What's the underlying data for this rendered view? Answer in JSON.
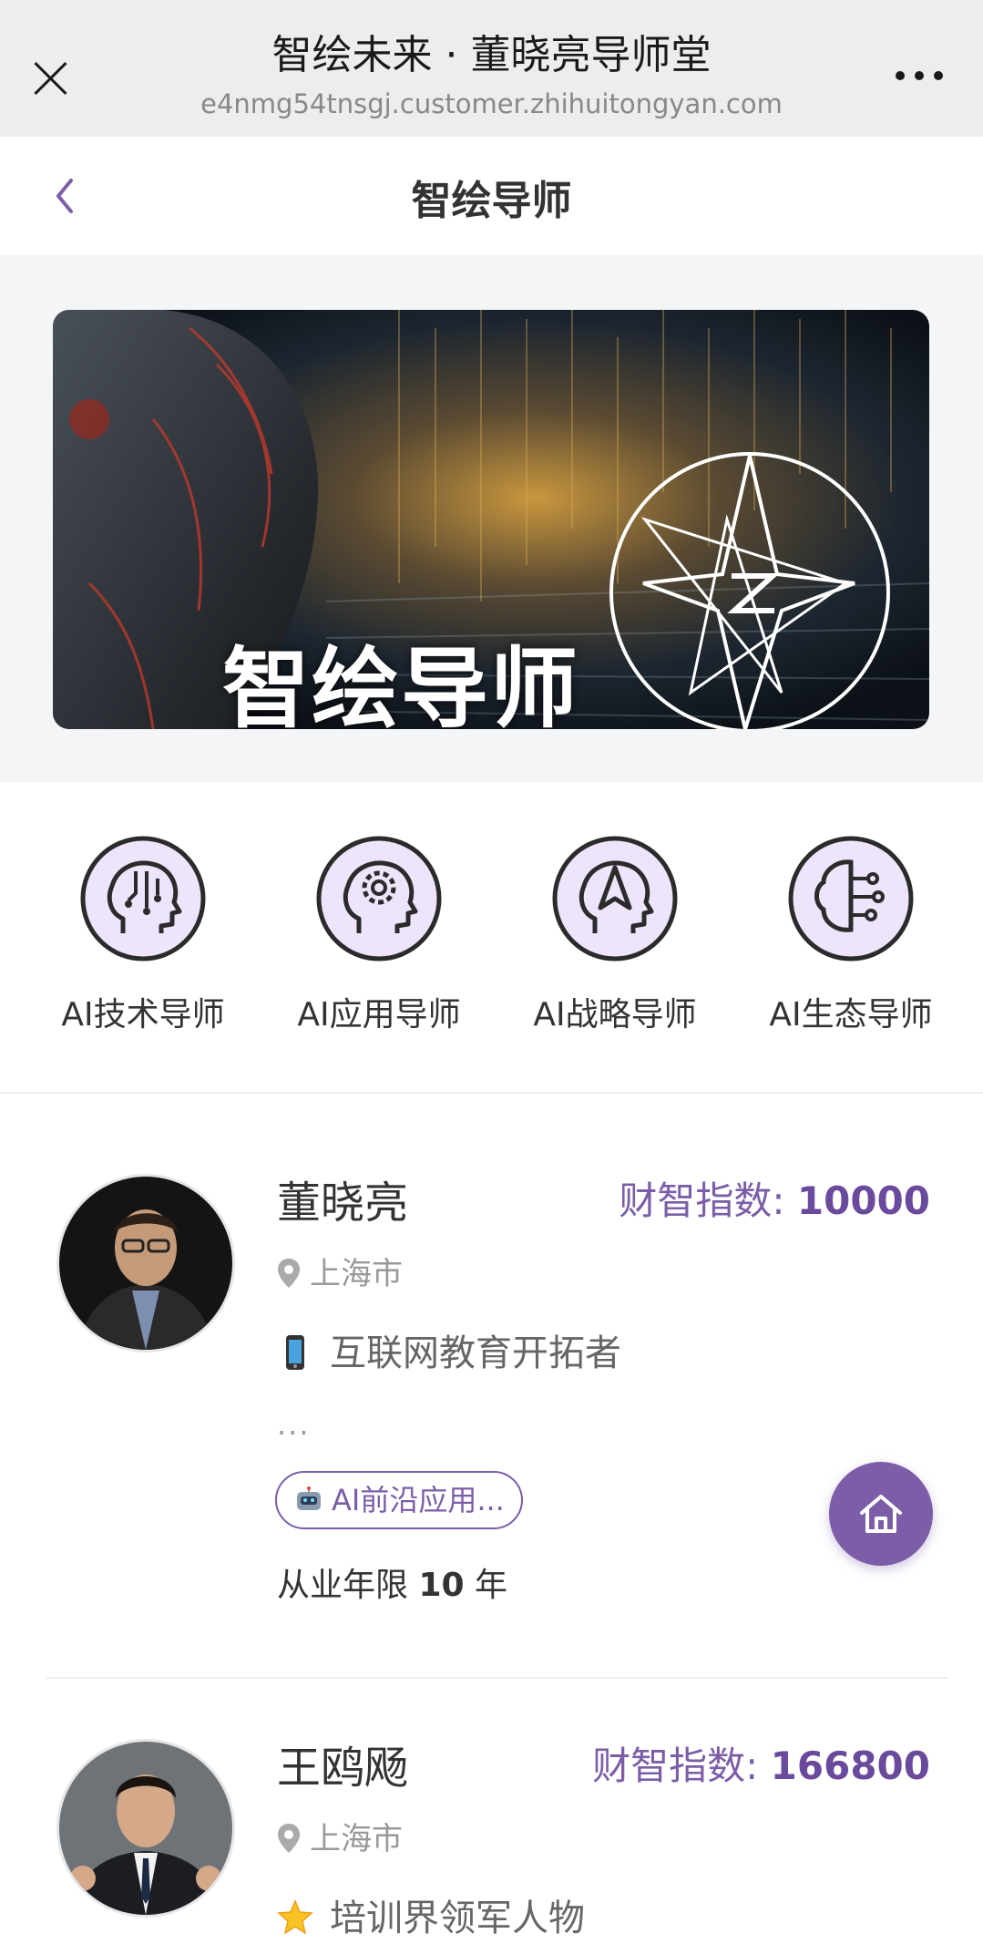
{
  "webview": {
    "title": "智绘未来 · 董晓亮导师堂",
    "url": "e4nmg54tnsgj.customer.zhihuitongyan.com"
  },
  "header": {
    "title": "智绘导师"
  },
  "banner": {
    "text": "智绘导师"
  },
  "categories": [
    {
      "label": "AI技术导师",
      "icon": "circuit-head-icon"
    },
    {
      "label": "AI应用导师",
      "icon": "gear-head-icon"
    },
    {
      "label": "AI战略导师",
      "icon": "compass-head-icon"
    },
    {
      "label": "AI生态导师",
      "icon": "brain-network-icon"
    }
  ],
  "mentors": [
    {
      "name": "董晓亮",
      "score_label": "财智指数: ",
      "score": "10000",
      "location": "上海市",
      "emoji": "mobile-phone",
      "description": "互联网教育开拓者",
      "more": "...",
      "tag": "AI前沿应用...",
      "years_prefix": "从业年限 ",
      "years": "10",
      "years_suffix": " 年"
    },
    {
      "name": "王鸥飏",
      "score_label": "财智指数: ",
      "score": "166800",
      "location": "上海市",
      "emoji": "glowing-star",
      "description": "培训界领军人物"
    }
  ],
  "colors": {
    "accent": "#7b5ea7",
    "accent_light": "#eee4fb",
    "background": "#f4f5f7"
  }
}
